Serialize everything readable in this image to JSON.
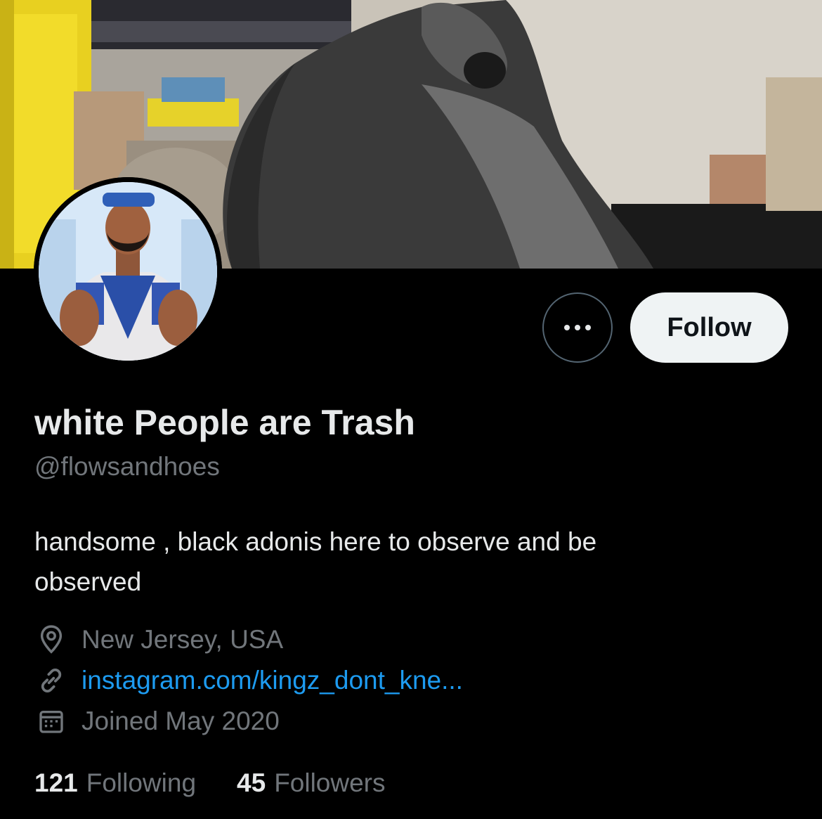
{
  "profile": {
    "display_name": "white People are Trash",
    "handle": "@flowsandhoes",
    "bio": "handsome , black adonis here to observe and be observed",
    "location": "New Jersey, USA",
    "website": "instagram.com/kingz_dont_kne...",
    "joined": "Joined May 2020"
  },
  "actions": {
    "follow_label": "Follow",
    "more_icon": "more-horizontal-icon"
  },
  "stats": {
    "following_count": "121",
    "following_label": "Following",
    "followers_count": "45",
    "followers_label": "Followers"
  },
  "icons": {
    "location": "location-pin-icon",
    "link": "link-icon",
    "calendar": "calendar-icon"
  },
  "colors": {
    "background": "#000000",
    "primary_text": "#e7e9ea",
    "secondary_text": "#71767b",
    "link": "#1d9bf0",
    "follow_button_bg": "#eff3f4",
    "border": "#536471"
  }
}
